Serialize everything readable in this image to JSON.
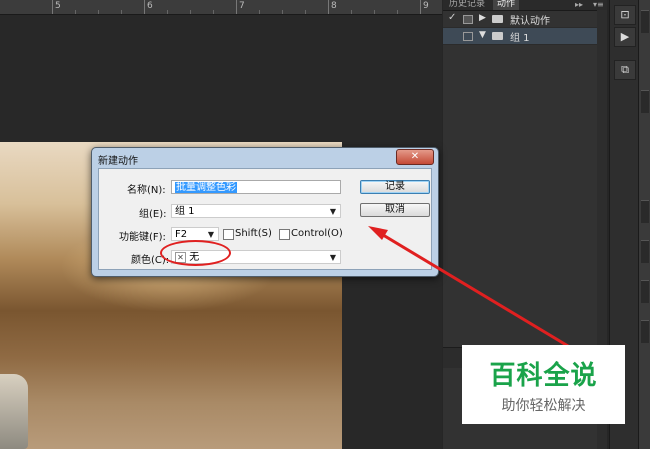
{
  "ruler": {
    "numbers": [
      "5",
      "6",
      "7",
      "8",
      "9"
    ]
  },
  "panel": {
    "tabs": [
      "历史记录",
      "动作"
    ],
    "menu_icons": [
      "▸▸",
      "▾≡"
    ],
    "rows": [
      {
        "check": "✓",
        "label": "默认动作"
      },
      {
        "check": "",
        "label": "组 1"
      }
    ]
  },
  "dialog": {
    "title": "新建动作",
    "close": "✕",
    "name_label": "名称(N):",
    "name_value": "批量调整色彩",
    "group_label": "组(E):",
    "group_value": "组 1",
    "fkey_label": "功能键(F):",
    "fkey_value": "F2",
    "shift_label": "Shift(S)",
    "control_label": "Control(O)",
    "color_label": "颜色(C):",
    "color_none_mark": "✕",
    "color_value": "无",
    "record_button": "记录",
    "cancel_button": "取消"
  },
  "tools": {
    "buttons": [
      "⊡",
      "▶",
      "⧉"
    ]
  },
  "watermark": {
    "main": "百科全说",
    "sub": "助你轻松解决"
  },
  "colors": {
    "annotation_red": "#e02020",
    "watermark_green": "#1aa34a"
  }
}
